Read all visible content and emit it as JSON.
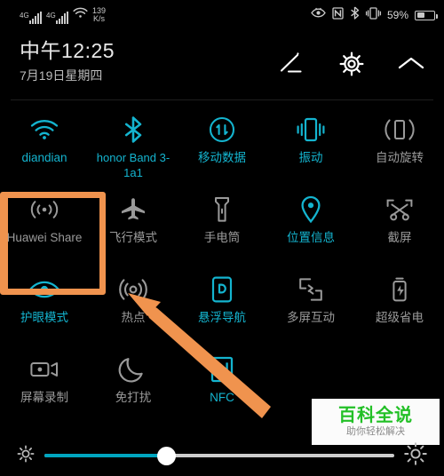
{
  "statusbar": {
    "sim1_network": "4G",
    "sim2_network": "4G",
    "wifi_icon": "wifi-icon",
    "net_speed_value": "139",
    "net_speed_unit": "K/s",
    "eye_comfort_icon": "eye-comfort-icon",
    "nfc_icon": "nfc-icon",
    "bluetooth_icon": "bluetooth-icon",
    "vibrate_icon": "vibrate-icon",
    "battery_percent": "59%",
    "battery_icon": "battery-charging-icon"
  },
  "header": {
    "time": "中午12:25",
    "date": "7月19日星期四",
    "edit_icon": "edit-pencil-icon",
    "settings_icon": "gear-icon",
    "collapse_icon": "chevron-up-icon"
  },
  "toggles": [
    {
      "id": "wifi",
      "icon": "wifi-icon",
      "label": "diandian",
      "active": true
    },
    {
      "id": "bluetooth",
      "icon": "bluetooth-icon",
      "label": "honor Band 3-1a1",
      "active": true
    },
    {
      "id": "mobile-data",
      "icon": "mobile-data-icon",
      "label": "移动数据",
      "active": true
    },
    {
      "id": "vibrate",
      "icon": "vibrate-icon",
      "label": "振动",
      "active": true
    },
    {
      "id": "auto-rotate",
      "icon": "auto-rotate-icon",
      "label": "自动旋转",
      "active": false
    },
    {
      "id": "huawei-share",
      "icon": "huawei-share-icon",
      "label": "Huawei Share",
      "active": false
    },
    {
      "id": "airplane-mode",
      "icon": "airplane-icon",
      "label": "飞行模式",
      "active": false
    },
    {
      "id": "flashlight",
      "icon": "flashlight-icon",
      "label": "手电筒",
      "active": false
    },
    {
      "id": "location",
      "icon": "location-pin-icon",
      "label": "位置信息",
      "active": true
    },
    {
      "id": "screenshot",
      "icon": "screenshot-icon",
      "label": "截屏",
      "active": false
    },
    {
      "id": "eye-comfort",
      "icon": "eye-icon",
      "label": "护眼模式",
      "active": true
    },
    {
      "id": "hotspot",
      "icon": "hotspot-icon",
      "label": "热点",
      "active": false
    },
    {
      "id": "nav-dock",
      "icon": "floating-nav-icon",
      "label": "悬浮导航",
      "active": true
    },
    {
      "id": "multi-screen",
      "icon": "multi-screen-icon",
      "label": "多屏互动",
      "active": false
    },
    {
      "id": "ultra-saver",
      "icon": "battery-saver-icon",
      "label": "超级省电",
      "active": false
    },
    {
      "id": "screen-record",
      "icon": "screen-record-icon",
      "label": "屏幕录制",
      "active": false
    },
    {
      "id": "do-not-disturb",
      "icon": "moon-icon",
      "label": "免打扰",
      "active": false
    },
    {
      "id": "nfc",
      "icon": "nfc-icon",
      "label": "NFC",
      "active": true
    },
    {
      "id": "empty-1",
      "icon": "",
      "label": "",
      "active": false
    },
    {
      "id": "empty-2",
      "icon": "",
      "label": "",
      "active": false
    }
  ],
  "annotation": {
    "highlight_color": "#f0934e",
    "highlight_target": "huawei-share",
    "arrow_color": "#f0934e",
    "arrow_target": "hotspot"
  },
  "watermark": {
    "title": "百科全说",
    "subtitle": "助你轻松解决",
    "title_color": "#22c026"
  },
  "brightness": {
    "low_icon": "brightness-low-icon",
    "high_icon": "brightness-high-icon",
    "value": 35,
    "accent_color": "#00a5bf"
  },
  "colors": {
    "active": "#14b4cf",
    "inactive": "#9a9a9a",
    "background": "#000000"
  }
}
